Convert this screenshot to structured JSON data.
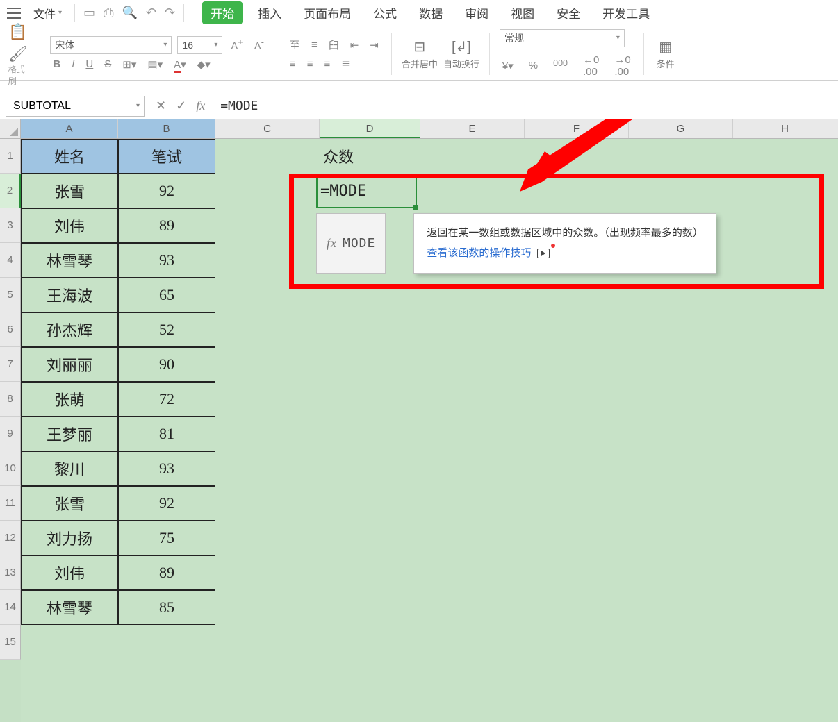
{
  "menubar": {
    "file_label": "文件",
    "save_tooltip_icon": "save",
    "tabs": [
      "开始",
      "插入",
      "页面布局",
      "公式",
      "数据",
      "审阅",
      "视图",
      "安全",
      "开发工具"
    ],
    "active_tab_index": 0,
    "right_cut": "条件"
  },
  "ribbon": {
    "format_painter": "格式刷",
    "font_name": "宋体",
    "font_size": "16",
    "merge_center": "合并居中",
    "wrap_text": "自动换行",
    "number_format": "常规"
  },
  "formula_bar": {
    "name_box": "SUBTOTAL",
    "formula": "=MODE"
  },
  "columns": [
    "A",
    "B",
    "C",
    "D",
    "E",
    "F",
    "G",
    "H"
  ],
  "rows": [
    "1",
    "2",
    "3",
    "4",
    "5",
    "6",
    "7",
    "8",
    "9",
    "10",
    "11",
    "12",
    "13",
    "14",
    "15"
  ],
  "table": {
    "headers": {
      "A": "姓名",
      "B": "笔试"
    },
    "data": [
      {
        "A": "张雪",
        "B": "92"
      },
      {
        "A": "刘伟",
        "B": "89"
      },
      {
        "A": "林雪琴",
        "B": "93"
      },
      {
        "A": "王海波",
        "B": "65"
      },
      {
        "A": "孙杰辉",
        "B": "52"
      },
      {
        "A": "刘丽丽",
        "B": "90"
      },
      {
        "A": "张萌",
        "B": "72"
      },
      {
        "A": "王梦丽",
        "B": "81"
      },
      {
        "A": "黎川",
        "B": "93"
      },
      {
        "A": "张雪",
        "B": "92"
      },
      {
        "A": "刘力扬",
        "B": "75"
      },
      {
        "A": "刘伟",
        "B": "89"
      },
      {
        "A": "林雪琴",
        "B": "85"
      }
    ]
  },
  "cell_D1": "众数",
  "cell_D2": "=MODE",
  "fn_suggest": {
    "name": "MODE",
    "desc": "返回在某一数组或数据区域中的众数。（出现频率最多的数）",
    "link": "查看该函数的操作技巧"
  },
  "right_edge_note": "条件",
  "merge_icon_label": "合并居中"
}
